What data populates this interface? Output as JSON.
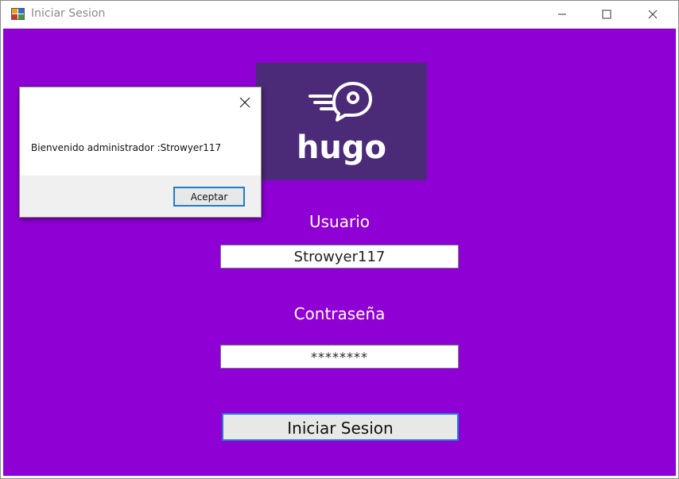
{
  "window": {
    "title": "Iniciar Sesion",
    "controls": {
      "minimize_icon": "minimize-icon",
      "maximize_icon": "maximize-icon",
      "close_icon": "close-icon"
    }
  },
  "logo": {
    "text": "hugo",
    "icon": "bird-icon",
    "background_color": "#4b2a78"
  },
  "form": {
    "background_color": "#8f00d4",
    "username_label": "Usuario",
    "username_value": "Strowyer117",
    "password_label": "Contraseña",
    "password_value": "********",
    "submit_label": "Iniciar Sesion"
  },
  "message_box": {
    "text": "Bienvenido administrador :Strowyer117",
    "ok_label": "Aceptar",
    "close_icon": "close-icon"
  },
  "colors": {
    "accent_border": "#1e7bd8",
    "client_background": "#8f00d4"
  }
}
